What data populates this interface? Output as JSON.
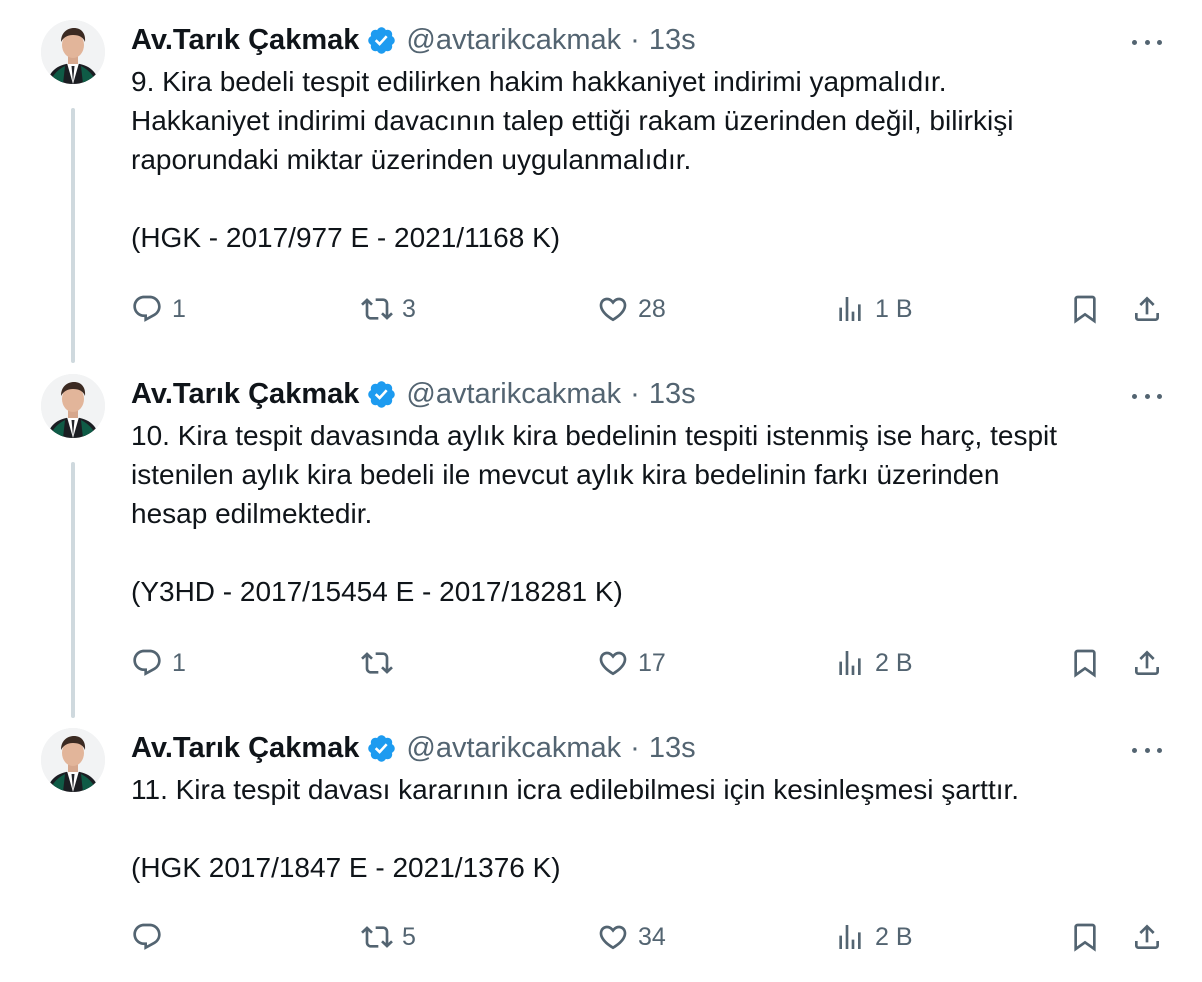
{
  "tweets": [
    {
      "author": {
        "name": "Av.Tarık Çakmak",
        "handle": "@avtarikcakmak",
        "verified": true
      },
      "time": "13s",
      "text": "9. Kira bedeli tespit edilirken hakim hakkaniyet indirimi yapmalıdır.\nHakkaniyet indirimi davacının talep ettiği rakam üzerinden değil, bilirkişi\nraporundaki miktar üzerinden uygulanmalıdır.",
      "reference": "(HGK - 2017/977 E - 2021/1168 K)",
      "stats": {
        "replies": "1",
        "retweets": "3",
        "likes": "28",
        "views": "1 B"
      }
    },
    {
      "author": {
        "name": "Av.Tarık Çakmak",
        "handle": "@avtarikcakmak",
        "verified": true
      },
      "time": "13s",
      "text": "10. Kira tespit davasında aylık kira bedelinin tespiti istenmiş ise harç, tespit\nistenilen aylık kira bedeli ile mevcut aylık kira bedelinin farkı üzerinden\nhesap edilmektedir.",
      "reference": "(Y3HD - 2017/15454 E - 2017/18281 K)",
      "stats": {
        "replies": "1",
        "retweets": "",
        "likes": "17",
        "views": "2 B"
      }
    },
    {
      "author": {
        "name": "Av.Tarık Çakmak",
        "handle": "@avtarikcakmak",
        "verified": true
      },
      "time": "13s",
      "text": "11. Kira tespit davası kararının icra edilebilmesi için kesinleşmesi şarttır.",
      "reference": "(HGK 2017/1847 E - 2021/1376 K)",
      "stats": {
        "replies": "",
        "retweets": "5",
        "likes": "34",
        "views": "2 B"
      }
    }
  ],
  "separator": "·",
  "icons": {
    "verified": "verified-badge-icon",
    "more": "more-dots-icon",
    "reply": "reply-icon",
    "retweet": "retweet-icon",
    "like": "heart-icon",
    "views": "views-icon",
    "bookmark": "bookmark-icon",
    "share": "share-icon"
  },
  "colors": {
    "text": "#0f1419",
    "secondary": "#536471",
    "verified": "#1d9bf0",
    "thread_line": "#cfd9de"
  }
}
